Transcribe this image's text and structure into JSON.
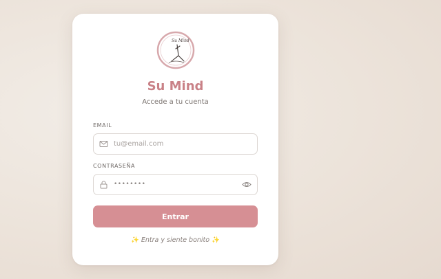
{
  "brand": {
    "name": "Su Mind",
    "logo_text": "Su Mind",
    "tagline_prefix": "Accede a tu cuenta"
  },
  "form": {
    "email_label": "EMAIL",
    "email_placeholder": "tu@email.com",
    "password_label": "CONTRASEÑA",
    "password_masked": "••••••••",
    "submit_label": "Entrar"
  },
  "footer": {
    "spark_left": "✨",
    "text": "Entra y siente bonito",
    "spark_right": "✨"
  },
  "icons": {
    "email": "mail-icon",
    "password": "lock-icon",
    "toggle": "eye-icon"
  },
  "colors": {
    "accent": "#c98187",
    "button": "#d68f94",
    "card": "#ffffff",
    "background": "#ece3da"
  }
}
